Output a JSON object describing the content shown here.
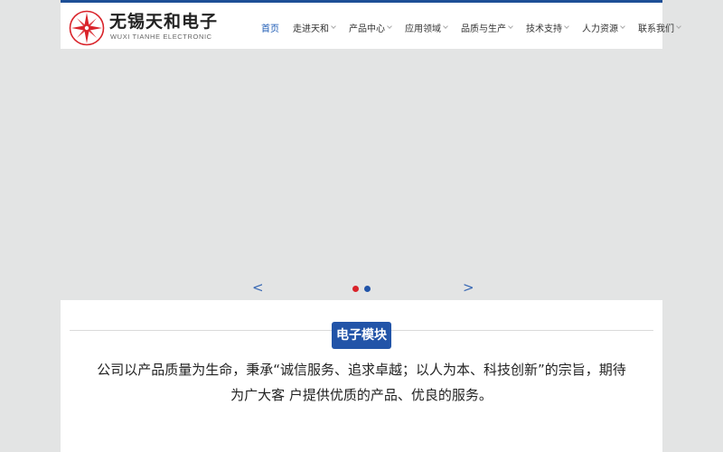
{
  "logo": {
    "cn": "无锡天和电子",
    "en": "WUXI TIANHE ELECTRONIC"
  },
  "nav": {
    "items": [
      {
        "label": "首页",
        "active": true,
        "dropdown": false
      },
      {
        "label": "走进天和",
        "dropdown": true
      },
      {
        "label": "产品中心",
        "dropdown": true
      },
      {
        "label": "应用领域",
        "dropdown": true
      },
      {
        "label": "品质与生产",
        "dropdown": true
      },
      {
        "label": "技术支持",
        "dropdown": true
      },
      {
        "label": "人力资源",
        "dropdown": true
      },
      {
        "label": "联系我们",
        "dropdown": true
      }
    ]
  },
  "slider": {
    "prev": "<",
    "next": ">",
    "dots": [
      {
        "active": true,
        "color": "#d9232a"
      },
      {
        "active": false,
        "color": "#2254a8"
      }
    ]
  },
  "section": {
    "title": "电子模块",
    "text_line1": "公司以产品质量为生命，秉承“诚信服务、追求卓越；以人为本、科技创新”的宗旨，期待",
    "text_line2": "为广大客 户提供优质的产品、优良的服务。"
  },
  "colors": {
    "brand_blue": "#1d4f96",
    "accent_red": "#d9232a",
    "banner_bg": "#e3e4e4"
  }
}
